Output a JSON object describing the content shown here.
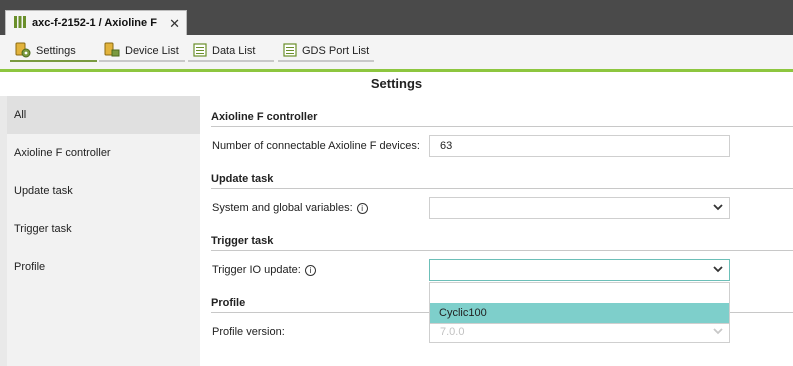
{
  "window": {
    "tab_title": "axc-f-2152-1 / Axioline F",
    "close_symbol": "✕"
  },
  "toolbar": {
    "items": [
      {
        "label": "Settings",
        "icon": "settings-icon"
      },
      {
        "label": "Device List",
        "icon": "device-list-icon"
      },
      {
        "label": "Data List",
        "icon": "data-list-icon"
      },
      {
        "label": "GDS Port List",
        "icon": "gds-port-list-icon"
      }
    ]
  },
  "page": {
    "title": "Settings"
  },
  "sidebar": {
    "items": [
      {
        "label": "All",
        "selected": true
      },
      {
        "label": "Axioline F controller"
      },
      {
        "label": "Update task"
      },
      {
        "label": "Trigger task"
      },
      {
        "label": "Profile"
      }
    ]
  },
  "sections": {
    "axioline": {
      "title": "Axioline F controller",
      "connectable_label": "Number of connectable Axioline F devices:",
      "connectable_value": "63"
    },
    "update": {
      "title": "Update task",
      "variables_label": "System and global variables:",
      "variables_value": ""
    },
    "trigger": {
      "title": "Trigger task",
      "io_label": "Trigger IO update:",
      "io_value": "",
      "dropdown_options": [
        "",
        "Cyclic100"
      ],
      "highlighted_option": "Cyclic100"
    },
    "profile": {
      "title": "Profile",
      "version_label": "Profile version:",
      "version_value": "7.0.0"
    }
  },
  "colors": {
    "accent_green": "#8dc63f",
    "highlight_teal": "#7ecfcb",
    "focus_border": "#6cbfb8",
    "dark_frame": "#4a4a4a"
  }
}
